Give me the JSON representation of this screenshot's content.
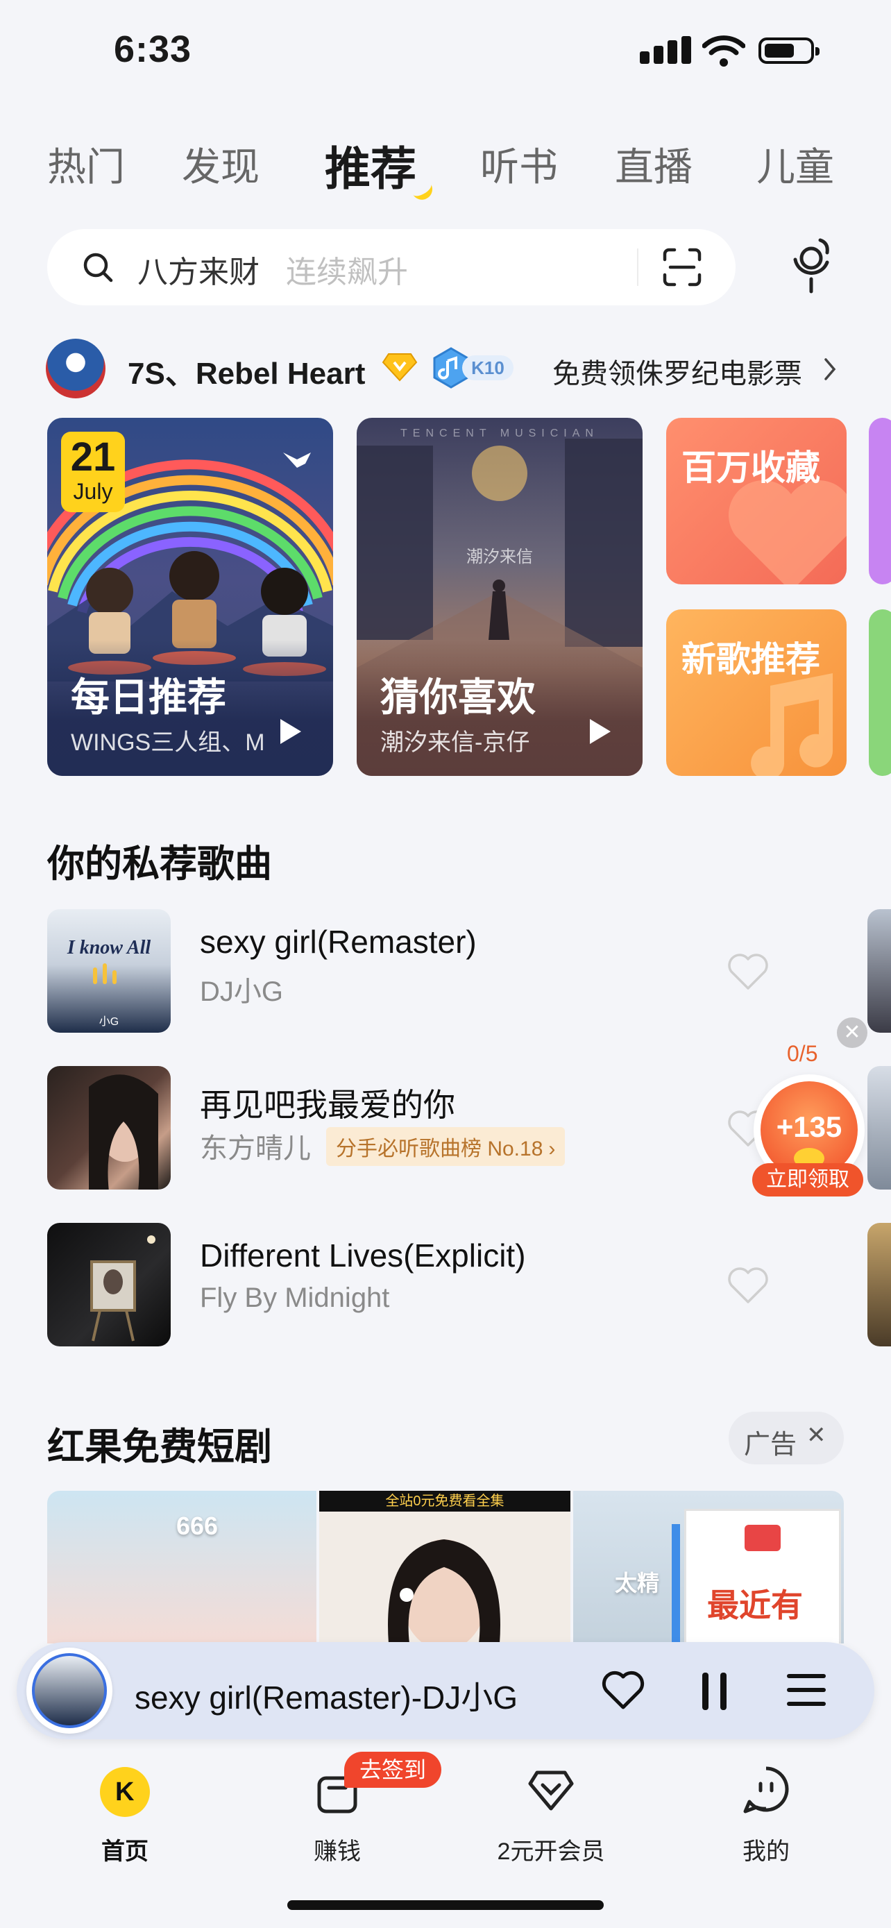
{
  "status_bar": {
    "time": "6:33"
  },
  "tabs": [
    {
      "label": "热门",
      "active": false
    },
    {
      "label": "发现",
      "active": false
    },
    {
      "label": "推荐",
      "active": true
    },
    {
      "label": "听书",
      "active": false
    },
    {
      "label": "直播",
      "active": false
    },
    {
      "label": "儿童",
      "active": false
    }
  ],
  "search": {
    "text": "八方来财",
    "hint": "连续飙升"
  },
  "user": {
    "name": "7S、Rebel Heart",
    "level": "K10",
    "promo": "免费领侏罗纪电影票"
  },
  "banners": {
    "daily": {
      "day": "21",
      "month": "July",
      "title": "每日推荐",
      "subtitle": "WINGS三人组、M"
    },
    "guess": {
      "title": "猜你喜欢",
      "subtitle": "潮汐来信-京仔",
      "watermark_top": "TENCENT MUSICIAN",
      "watermark_mid": "潮汐来信"
    },
    "collect": {
      "title": "百万收藏"
    },
    "newsongs": {
      "title": "新歌推荐"
    }
  },
  "private_section": {
    "title": "你的私荐歌曲",
    "songs": [
      {
        "title": "sexy girl(Remaster)",
        "artist": "DJ小G",
        "cover_text": "I know All",
        "cover_sub": "小G"
      },
      {
        "title": "再见吧我最爱的你",
        "artist": "东方晴儿",
        "tag": "分手必听歌曲榜 No.18"
      },
      {
        "title": "Different Lives(Explicit)",
        "artist": "Fly By Midnight"
      }
    ]
  },
  "reward": {
    "progress": "0/5",
    "points": "+135",
    "action": "立即领取"
  },
  "drama_section": {
    "title": "红果免费短剧",
    "ad_label": "广告",
    "thumb1_text": "666",
    "thumb2_banner": "全站0元免费看全集",
    "thumb3_text": "太精",
    "popup_text": "最近有"
  },
  "player": {
    "now_playing": "sexy girl(Remaster)-DJ小G"
  },
  "bottom_nav": [
    {
      "label": "首页",
      "active": true
    },
    {
      "label": "赚钱",
      "badge": "去签到"
    },
    {
      "label": "2元开会员"
    },
    {
      "label": "我的"
    }
  ]
}
